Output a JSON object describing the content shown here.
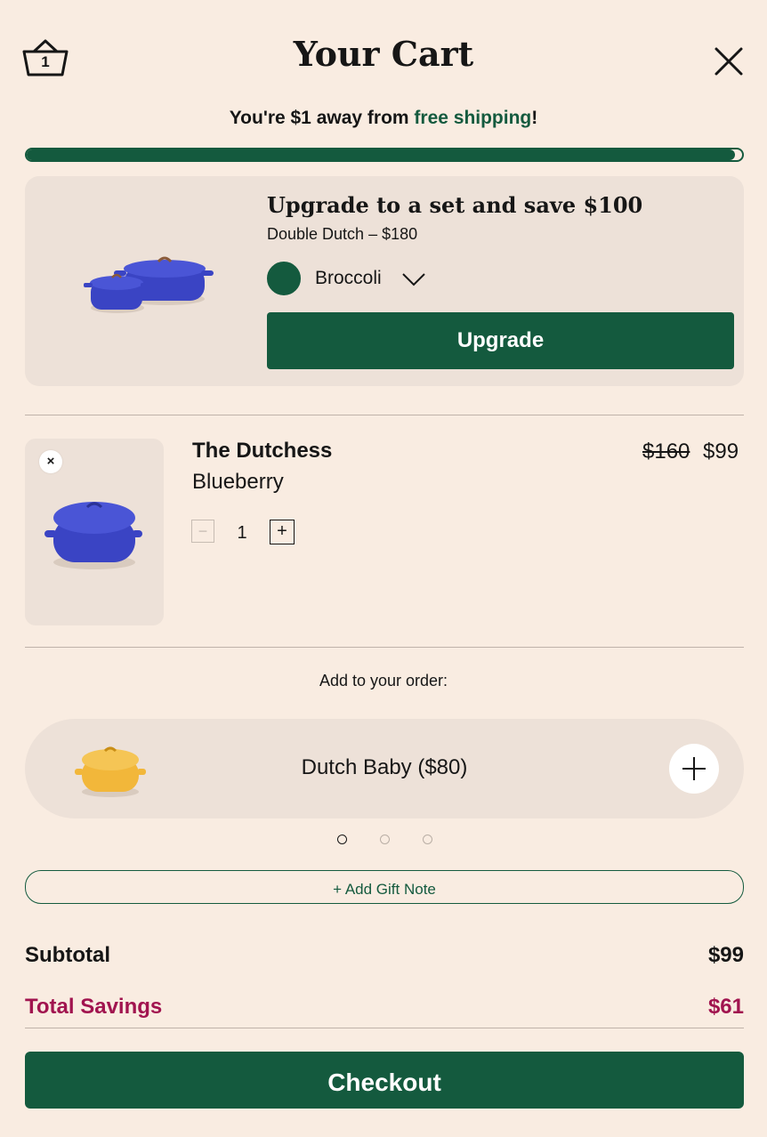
{
  "header": {
    "title": "Your Cart",
    "cart_count": "1"
  },
  "shipping": {
    "prefix": "You're $1 away from ",
    "highlight": "free shipping",
    "suffix": "!",
    "progress_fraction": 0.99
  },
  "upgrade": {
    "title": "Upgrade to a set and save $100",
    "subtitle": "Double Dutch – $180",
    "color_label": "Broccoli",
    "color_hex": "#145a3e",
    "product_color_hex": "#3a44c4",
    "button_label": "Upgrade"
  },
  "line_item": {
    "name": "The Dutchess",
    "variant": "Blueberry",
    "price_original": "$160",
    "price_sale": "$99",
    "quantity": "1",
    "remove_icon": "×",
    "minus_icon": "−",
    "plus_icon": "+",
    "product_color_hex": "#3a44c4"
  },
  "add_to_order": {
    "heading": "Add to your order:",
    "product_label": "Dutch Baby ($80)",
    "product_color_hex": "#f2b73a",
    "carousel_active_index": 0,
    "carousel_count": 3
  },
  "gift_note_label": "+ Add Gift Note",
  "summary": {
    "subtotal_label": "Subtotal",
    "subtotal_value": "$99",
    "savings_label": "Total Savings",
    "savings_value": "$61"
  },
  "checkout_label": "Checkout",
  "colors": {
    "brand_green": "#145a3e",
    "savings_magenta": "#a1144f",
    "background": "#f9ece1",
    "card": "#ede1d8"
  }
}
